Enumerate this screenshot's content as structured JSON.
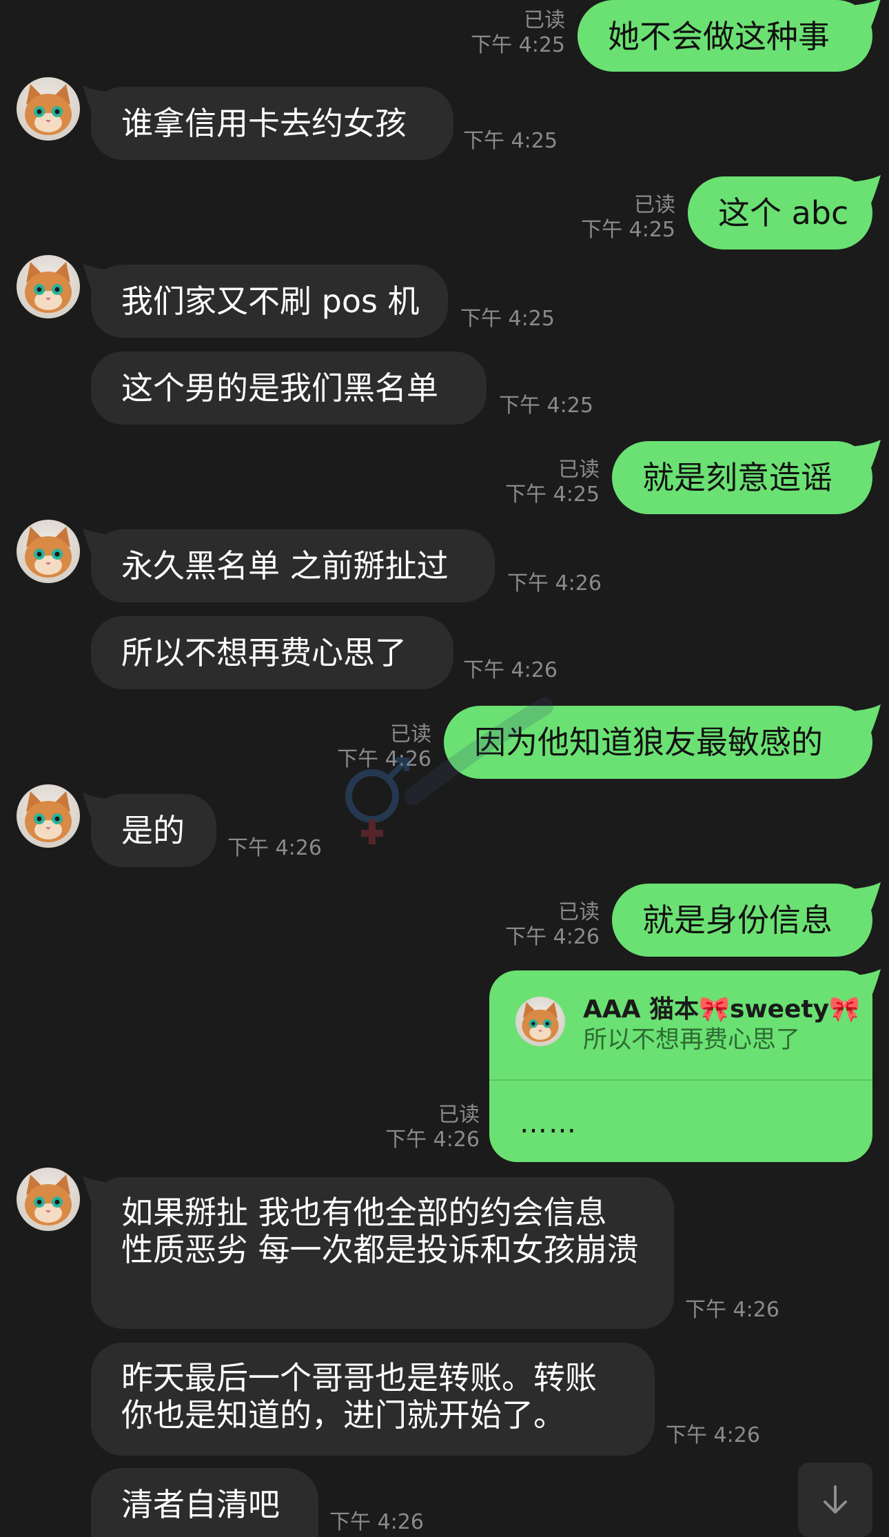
{
  "colors": {
    "background": "#1b1b1b",
    "incoming_bubble": "#2c2c2c",
    "outgoing_bubble": "#6ae172",
    "meta_text": "#8b8b8b"
  },
  "messages": [
    {
      "dir": "out",
      "text": "她不会做这种事",
      "read": "已读",
      "time": "下午 4:25"
    },
    {
      "dir": "in",
      "text": "谁拿信用卡去约女孩",
      "time": "下午 4:25"
    },
    {
      "dir": "out",
      "text": "这个 abc",
      "read": "已读",
      "time": "下午 4:25"
    },
    {
      "dir": "in",
      "text": "我们家又不刷 pos 机",
      "time": "下午 4:25"
    },
    {
      "dir": "in",
      "text": "这个男的是我们黑名单",
      "time": "下午 4:25"
    },
    {
      "dir": "out",
      "text": "就是刻意造谣",
      "read": "已读",
      "time": "下午 4:25"
    },
    {
      "dir": "in",
      "text": "永久黑名单 之前掰扯过",
      "time": "下午 4:26"
    },
    {
      "dir": "in",
      "text": "所以不想再费心思了",
      "time": "下午 4:26"
    },
    {
      "dir": "out",
      "text": "因为他知道狼友最敏感的",
      "read": "已读",
      "time": "下午 4:26"
    },
    {
      "dir": "in",
      "text": "是的",
      "time": "下午 4:26"
    },
    {
      "dir": "out",
      "text": "就是身份信息",
      "read": "已读",
      "time": "下午 4:26"
    },
    {
      "dir": "in",
      "text": "如果掰扯 我也有他全部的约会信息 性质恶劣 每一次都是投诉和女孩崩溃",
      "time": "下午 4:26"
    },
    {
      "dir": "in",
      "text": "昨天最后一个哥哥也是转账。转账你也是知道的，进门就开始了。",
      "time": "下午 4:26"
    },
    {
      "dir": "in",
      "text": "清者自清吧",
      "time": "下午 4:26"
    }
  ],
  "reply_message": {
    "quoted_name": "AAA 猫本🎀sweety🎀",
    "quoted_text": "所以不想再费心思了",
    "text": "……",
    "read": "已读",
    "time": "下午 4:26"
  },
  "icons": {
    "avatar": "cat-avatar-icon",
    "scroll": "arrow-down-icon"
  }
}
